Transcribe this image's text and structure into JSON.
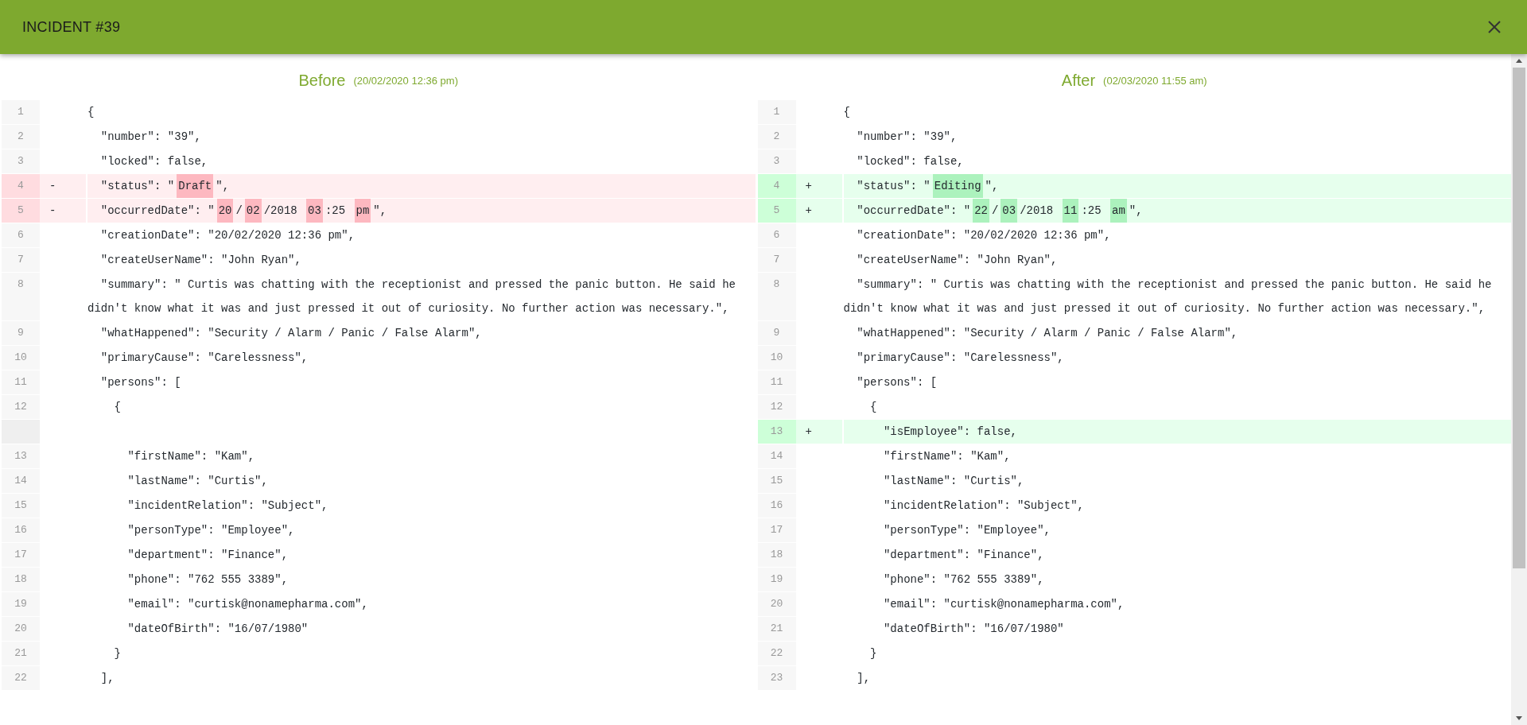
{
  "dialog": {
    "title": "INCIDENT #39"
  },
  "panes": [
    {
      "heading": "Before",
      "timestamp": "(20/02/2020 12:36 pm)",
      "lines": [
        {
          "kind": "same",
          "number": "1",
          "text": "{"
        },
        {
          "kind": "same",
          "number": "2",
          "text": "  \"number\": \"39\","
        },
        {
          "kind": "same",
          "number": "3",
          "text": "  \"locked\": false,"
        },
        {
          "kind": "removed",
          "number": "4",
          "marker": "-",
          "segments": [
            {
              "text": "  \"status\": \"",
              "changed": false
            },
            {
              "text": "Draft",
              "changed": true
            },
            {
              "text": "\",",
              "changed": false
            }
          ]
        },
        {
          "kind": "removed",
          "number": "5",
          "marker": "-",
          "segments": [
            {
              "text": "  \"occurredDate\": \"",
              "changed": false
            },
            {
              "text": "20",
              "changed": true
            },
            {
              "text": "/",
              "changed": false
            },
            {
              "text": "02",
              "changed": true
            },
            {
              "text": "/2018 ",
              "changed": false
            },
            {
              "text": "03",
              "changed": true
            },
            {
              "text": ":25 ",
              "changed": false
            },
            {
              "text": "pm",
              "changed": true
            },
            {
              "text": "\",",
              "changed": false
            }
          ]
        },
        {
          "kind": "same",
          "number": "6",
          "text": "  \"creationDate\": \"20/02/2020 12:36 pm\","
        },
        {
          "kind": "same",
          "number": "7",
          "text": "  \"createUserName\": \"John Ryan\","
        },
        {
          "kind": "same",
          "number": "8",
          "text": "  \"summary\": \" Curtis was chatting with the receptionist and pressed the panic button. He said he didn't know what it was and just pressed it out of curiosity. No further action was necessary.\","
        },
        {
          "kind": "same",
          "number": "9",
          "text": "  \"whatHappened\": \"Security / Alarm / Panic / False Alarm\","
        },
        {
          "kind": "same",
          "number": "10",
          "text": "  \"primaryCause\": \"Carelessness\","
        },
        {
          "kind": "same",
          "number": "11",
          "text": "  \"persons\": ["
        },
        {
          "kind": "same",
          "number": "12",
          "text": "    {"
        },
        {
          "kind": "blank"
        },
        {
          "kind": "same",
          "number": "13",
          "text": "      \"firstName\": \"Kam\","
        },
        {
          "kind": "same",
          "number": "14",
          "text": "      \"lastName\": \"Curtis\","
        },
        {
          "kind": "same",
          "number": "15",
          "text": "      \"incidentRelation\": \"Subject\","
        },
        {
          "kind": "same",
          "number": "16",
          "text": "      \"personType\": \"Employee\","
        },
        {
          "kind": "same",
          "number": "17",
          "text": "      \"department\": \"Finance\","
        },
        {
          "kind": "same",
          "number": "18",
          "text": "      \"phone\": \"762 555 3389\","
        },
        {
          "kind": "same",
          "number": "19",
          "text": "      \"email\": \"curtisk@nonamepharma.com\","
        },
        {
          "kind": "same",
          "number": "20",
          "text": "      \"dateOfBirth\": \"16/07/1980\""
        },
        {
          "kind": "same",
          "number": "21",
          "text": "    }"
        },
        {
          "kind": "same",
          "number": "22",
          "text": "  ],"
        }
      ]
    },
    {
      "heading": "After",
      "timestamp": "(02/03/2020 11:55 am)",
      "lines": [
        {
          "kind": "same",
          "number": "1",
          "text": "{"
        },
        {
          "kind": "same",
          "number": "2",
          "text": "  \"number\": \"39\","
        },
        {
          "kind": "same",
          "number": "3",
          "text": "  \"locked\": false,"
        },
        {
          "kind": "added",
          "number": "4",
          "marker": "+",
          "segments": [
            {
              "text": "  \"status\": \"",
              "changed": false
            },
            {
              "text": "Editing",
              "changed": true
            },
            {
              "text": "\",",
              "changed": false
            }
          ]
        },
        {
          "kind": "added",
          "number": "5",
          "marker": "+",
          "segments": [
            {
              "text": "  \"occurredDate\": \"",
              "changed": false
            },
            {
              "text": "22",
              "changed": true
            },
            {
              "text": "/",
              "changed": false
            },
            {
              "text": "03",
              "changed": true
            },
            {
              "text": "/2018 ",
              "changed": false
            },
            {
              "text": "11",
              "changed": true
            },
            {
              "text": ":25 ",
              "changed": false
            },
            {
              "text": "am",
              "changed": true
            },
            {
              "text": "\",",
              "changed": false
            }
          ]
        },
        {
          "kind": "same",
          "number": "6",
          "text": "  \"creationDate\": \"20/02/2020 12:36 pm\","
        },
        {
          "kind": "same",
          "number": "7",
          "text": "  \"createUserName\": \"John Ryan\","
        },
        {
          "kind": "same",
          "number": "8",
          "text": "  \"summary\": \" Curtis was chatting with the receptionist and pressed the panic button. He said he didn't know what it was and just pressed it out of curiosity. No further action was necessary.\","
        },
        {
          "kind": "same",
          "number": "9",
          "text": "  \"whatHappened\": \"Security / Alarm / Panic / False Alarm\","
        },
        {
          "kind": "same",
          "number": "10",
          "text": "  \"primaryCause\": \"Carelessness\","
        },
        {
          "kind": "same",
          "number": "11",
          "text": "  \"persons\": ["
        },
        {
          "kind": "same",
          "number": "12",
          "text": "    {"
        },
        {
          "kind": "added",
          "number": "13",
          "marker": "+",
          "segments": [
            {
              "text": "      \"isEmployee\": false,",
              "changed": false
            }
          ]
        },
        {
          "kind": "same",
          "number": "14",
          "text": "      \"firstName\": \"Kam\","
        },
        {
          "kind": "same",
          "number": "15",
          "text": "      \"lastName\": \"Curtis\","
        },
        {
          "kind": "same",
          "number": "16",
          "text": "      \"incidentRelation\": \"Subject\","
        },
        {
          "kind": "same",
          "number": "17",
          "text": "      \"personType\": \"Employee\","
        },
        {
          "kind": "same",
          "number": "18",
          "text": "      \"department\": \"Finance\","
        },
        {
          "kind": "same",
          "number": "19",
          "text": "      \"phone\": \"762 555 3389\","
        },
        {
          "kind": "same",
          "number": "20",
          "text": "      \"email\": \"curtisk@nonamepharma.com\","
        },
        {
          "kind": "same",
          "number": "21",
          "text": "      \"dateOfBirth\": \"16/07/1980\""
        },
        {
          "kind": "same",
          "number": "22",
          "text": "    }"
        },
        {
          "kind": "same",
          "number": "23",
          "text": "  ],"
        }
      ]
    }
  ]
}
